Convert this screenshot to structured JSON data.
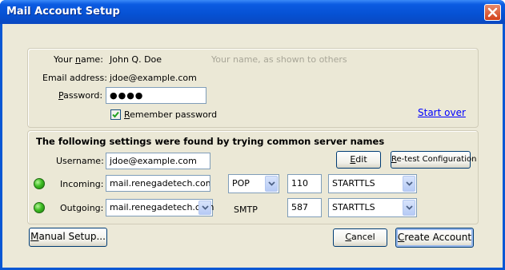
{
  "window": {
    "title": "Mail Account Setup"
  },
  "account": {
    "name_label_pre": "Your ",
    "name_label_ak": "n",
    "name_label_post": "ame:",
    "name_value": "John Q. Doe",
    "name_hint": "Your name, as shown to others",
    "email_label": "Email address:",
    "email_value": "jdoe@example.com",
    "password_label_ak": "P",
    "password_label_post": "assword:",
    "password_value": "●●●●",
    "remember_ak": "R",
    "remember_post": "emember password",
    "remember_checked": true,
    "start_over": "Start over"
  },
  "settings": {
    "heading": "The following settings were found by trying common server names",
    "username_label": "Username:",
    "username_value": "jdoe@example.com",
    "edit_ak": "E",
    "edit_post": "dit",
    "retest_ak": "R",
    "retest_post": "e-test Configuration",
    "incoming": {
      "label": "Incoming:",
      "server": "mail.renegadetech.com",
      "protocol": "POP",
      "port": "110",
      "security": "STARTTLS",
      "status_color": "#3fbd24"
    },
    "outgoing": {
      "label": "Outgoing:",
      "server": "mail.renegadetech.com",
      "protocol": "SMTP",
      "port": "587",
      "security": "STARTTLS",
      "status_color": "#3fbd24"
    }
  },
  "footer": {
    "manual_ak": "M",
    "manual_post": "anual Setup...",
    "cancel_pre": "",
    "cancel_ak": "C",
    "cancel_post": "ancel",
    "create_ak": "C",
    "create_post": "reate Account"
  }
}
